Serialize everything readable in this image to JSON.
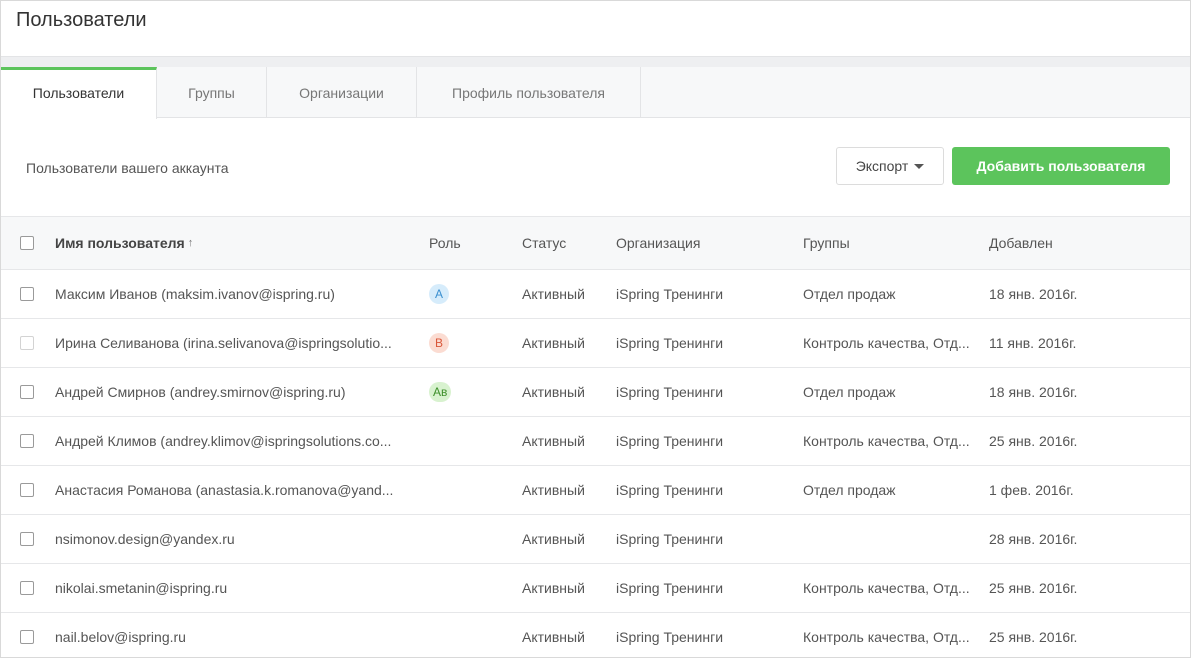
{
  "page_title": "Пользователи",
  "tabs": [
    {
      "label": "Пользователи",
      "active": true
    },
    {
      "label": "Группы",
      "active": false
    },
    {
      "label": "Организации",
      "active": false
    },
    {
      "label": "Профиль пользователя",
      "active": false
    }
  ],
  "toolbar": {
    "subtitle": "Пользователи вашего аккаунта",
    "export_label": "Экспорт",
    "export_icon": "caret-down-icon",
    "add_label": "Добавить пользователя"
  },
  "table": {
    "columns": {
      "name": "Имя пользователя",
      "name_sort": "↑",
      "role": "Роль",
      "status": "Статус",
      "org": "Организация",
      "groups": "Группы",
      "added": "Добавлен"
    },
    "rows": [
      {
        "name": "Максим Иванов (maksim.ivanov@ispring.ru)",
        "role": "A",
        "status": "Активный",
        "org": "iSpring Тренинги",
        "groups": "Отдел продаж",
        "added": "18 янв. 2016г."
      },
      {
        "name": "Ирина Селиванова (irina.selivanova@ispringsolutio...",
        "role": "B",
        "status": "Активный",
        "org": "iSpring Тренинги",
        "groups": "Контроль качества, Отд...",
        "added": "11 янв. 2016г."
      },
      {
        "name": "Андрей Смирнов (andrey.smirnov@ispring.ru)",
        "role": "Ав",
        "status": "Активный",
        "org": "iSpring Тренинги",
        "groups": "Отдел продаж",
        "added": "18 янв. 2016г."
      },
      {
        "name": "Андрей Климов (andrey.klimov@ispringsolutions.co...",
        "role": "",
        "status": "Активный",
        "org": "iSpring Тренинги",
        "groups": "Контроль качества, Отд...",
        "added": "25 янв. 2016г."
      },
      {
        "name": "Анастасия Романова (anastasia.k.romanova@yand...",
        "role": "",
        "status": "Активный",
        "org": "iSpring Тренинги",
        "groups": "Отдел продаж",
        "added": "1 фев. 2016г."
      },
      {
        "name": "nsimonov.design@yandex.ru",
        "role": "",
        "status": "Активный",
        "org": "iSpring Тренинги",
        "groups": "",
        "added": "28 янв. 2016г."
      },
      {
        "name": "nikolai.smetanin@ispring.ru",
        "role": "",
        "status": "Активный",
        "org": "iSpring Тренинги",
        "groups": "Контроль качества, Отд...",
        "added": "25 янв. 2016г."
      },
      {
        "name": "nail.belov@ispring.ru",
        "role": "",
        "status": "Активный",
        "org": "iSpring Тренинги",
        "groups": "Контроль качества, Отд...",
        "added": "25 янв. 2016г."
      }
    ]
  },
  "colors": {
    "accent": "#5cc45c",
    "badge_a_bg": "#d6ecfb",
    "badge_a_fg": "#3a8fd0",
    "badge_b_bg": "#fbdcd2",
    "badge_b_fg": "#d9573a",
    "badge_av_bg": "#d8f2cf",
    "badge_av_fg": "#3d8f2a"
  }
}
